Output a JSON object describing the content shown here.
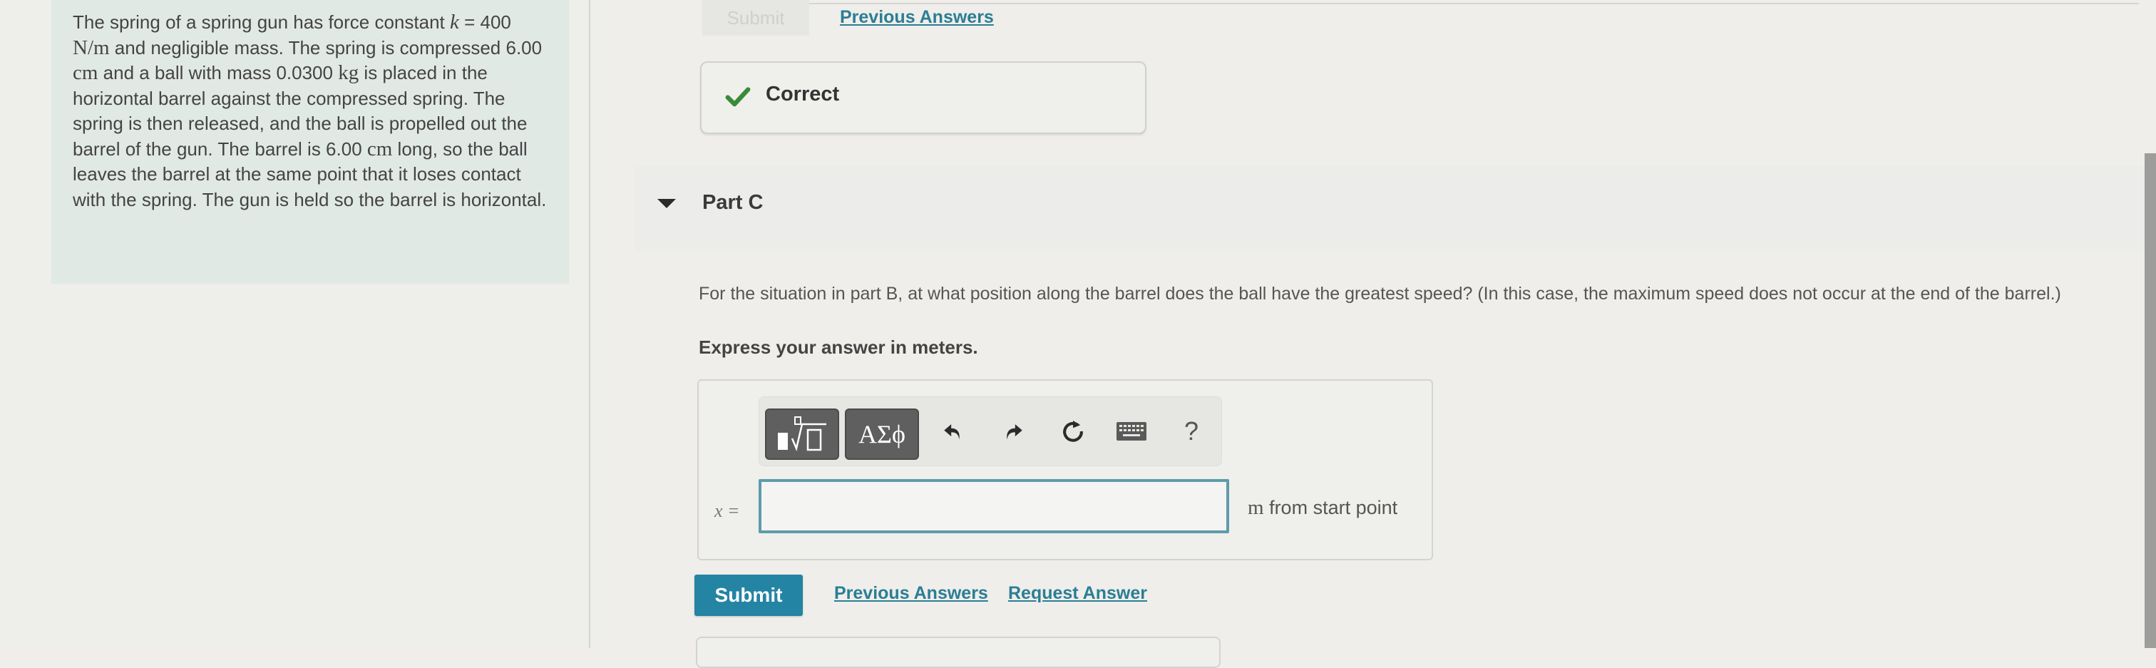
{
  "problem": {
    "segments": [
      {
        "t": "The spring of a spring gun has force constant "
      },
      {
        "t": "k",
        "cls": "math-i"
      },
      {
        "t": " = 400 "
      },
      {
        "t": "N/m",
        "cls": "math"
      },
      {
        "t": " and negligible mass. The spring is compressed 6.00 "
      },
      {
        "t": "cm",
        "cls": "math"
      },
      {
        "t": " and a ball with mass 0.0300 "
      },
      {
        "t": "kg",
        "cls": "math"
      },
      {
        "t": " is placed in the horizontal barrel against the compressed spring. The spring is then released, and the ball is propelled out the barrel of the gun. The barrel is 6.00 "
      },
      {
        "t": "cm",
        "cls": "math"
      },
      {
        "t": " long, so the ball leaves the barrel at the same point that it loses contact with the spring. The gun is held so the barrel is horizontal."
      }
    ]
  },
  "part_b": {
    "submit_label": "Submit",
    "previous_answers_label": "Previous Answers",
    "feedback": {
      "icon": "check-icon",
      "label": "Correct",
      "color": "#3a8a3a"
    }
  },
  "part_c": {
    "title": "Part C",
    "question": "For the situation in part B, at what position along the barrel does the ball have the greatest speed? (In this case, the maximum speed does not occur at the end of the barrel.)",
    "instruction": "Express your answer in meters.",
    "toolbar": {
      "buttons": [
        {
          "name": "templates-button",
          "icon": "templates-icon"
        },
        {
          "name": "greek-symbols-button",
          "label": "ΑΣϕ"
        },
        {
          "name": "undo-button",
          "icon": "undo-icon"
        },
        {
          "name": "redo-button",
          "icon": "redo-icon"
        },
        {
          "name": "reset-button",
          "icon": "reset-icon"
        },
        {
          "name": "keyboard-button",
          "icon": "keyboard-icon"
        },
        {
          "name": "help-button",
          "label": "?"
        }
      ]
    },
    "variable_label": "x =",
    "answer_value": "",
    "units_math": "m",
    "units_text": " from start point",
    "submit_label": "Submit",
    "previous_answers_label": "Previous Answers",
    "request_answer_label": "Request Answer"
  },
  "colors": {
    "accent": "#2484a3",
    "link": "#2a7e95",
    "correct": "#3a8a3a",
    "input_border": "#5e9bab"
  }
}
